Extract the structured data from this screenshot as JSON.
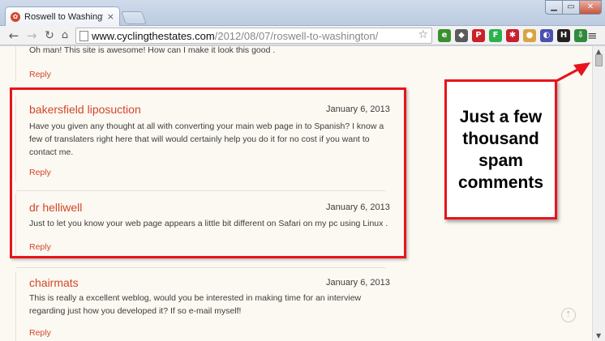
{
  "browser": {
    "tab_title": "Roswell to Washington | C",
    "tab_close": "×",
    "url_domain": "www.cyclingthestates.com",
    "url_path": "/2012/08/07/roswell-to-washington/",
    "window_controls": {
      "minimize": "▁",
      "maximize": "▭",
      "close": "✕"
    },
    "extensions": [
      {
        "icon": "evernote-icon",
        "color": "#3b8f2f"
      },
      {
        "icon": "pushbullet-icon",
        "color": "#5a5a5a"
      },
      {
        "icon": "pinterest-icon",
        "color": "#cb2027"
      },
      {
        "icon": "feedly-icon",
        "color": "#2bb24c"
      },
      {
        "icon": "lastpass-icon",
        "color": "#c8202f"
      },
      {
        "icon": "cookie-icon",
        "color": "#d9a441"
      },
      {
        "icon": "pocket-icon",
        "color": "#4a4fb0"
      },
      {
        "icon": "hootsuite-icon",
        "color": "#222222"
      },
      {
        "icon": "download-icon",
        "color": "#2f8a3a"
      }
    ]
  },
  "comments": {
    "top_comment_text": "Oh man! This site is awesome! How can I make it look this good .",
    "top_reply": "Reply",
    "items": [
      {
        "author": "bakersfield liposuction",
        "date": "January 6, 2013",
        "text_lines": [
          "Have you given any thought at all with converting your main web page in to Spanish? I know a",
          "few of translaters right here that will would certainly help you do it for no cost if you want to",
          "contact me."
        ],
        "reply": "Reply"
      },
      {
        "author": "dr helliwell",
        "date": "January 6, 2013",
        "text_lines": [
          "Just to let you know your web page appears a little bit different on Safari on my pc using Linux ."
        ],
        "reply": "Reply"
      },
      {
        "author": "chairmats",
        "date": "January 6, 2013",
        "text_lines": [
          "This is really a excellent weblog, would you be interested in making time for an interview",
          "regarding just how you developed it? If so e-mail myself!"
        ],
        "reply": "Reply"
      }
    ]
  },
  "annotation": {
    "callout_lines": [
      "Just a few",
      "thousand",
      "spam",
      "comments"
    ],
    "color": "#e8141c"
  }
}
